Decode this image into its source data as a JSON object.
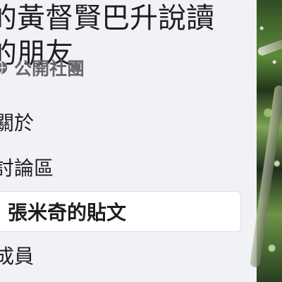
{
  "group": {
    "title_line_1": "的黃督賢巴升說讀",
    "title_line_2": "的朋友",
    "privacy": "公開社團"
  },
  "nav": {
    "items": [
      {
        "label": "關於",
        "active": false
      },
      {
        "label": "討論區",
        "active": false
      },
      {
        "label": "張米奇的貼文",
        "active": true
      },
      {
        "label": "成員",
        "active": false
      }
    ]
  },
  "colors": {
    "sidebar_bg": "#f0f2f5",
    "active_item_bg": "#ffffff",
    "text_primary": "#1c1e21",
    "text_secondary": "#65676b"
  },
  "icons": {
    "privacy_icon": "globe-icon"
  }
}
